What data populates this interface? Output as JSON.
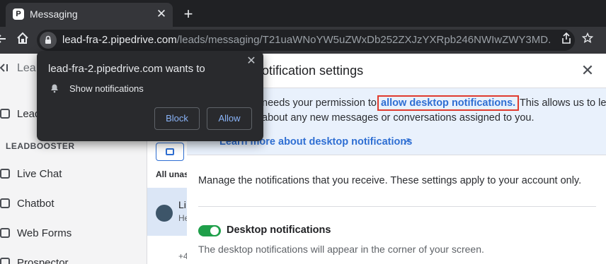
{
  "browser": {
    "tab_title": "Messaging",
    "tab_favicon": "P",
    "tab_close": "✕",
    "new_tab": "+",
    "url_host": "lead-fra-2.pipedrive.com",
    "url_path": "/leads/messaging/T21uaWNoYW5uZWxDb252ZXJzYXRpb246NWIwZWY3MD...",
    "icons": {
      "back": "back-icon",
      "home": "home-icon",
      "share": "share-icon",
      "star": "star-icon"
    }
  },
  "permission_popup": {
    "title": "lead-fra-2.pipedrive.com wants to",
    "permission": "Show notifications",
    "block_label": "Block",
    "allow_label": "Allow",
    "close": "✕"
  },
  "sidebar": {
    "header": "Lea",
    "top_item": "Lead",
    "section_title": "LEADBOOSTER",
    "items": [
      {
        "label": "Live Chat",
        "icon": "live-chat-icon"
      },
      {
        "label": "Chatbot",
        "icon": "chatbot-icon"
      },
      {
        "label": "Web Forms",
        "icon": "web-forms-icon"
      },
      {
        "label": "Prospector",
        "icon": "prospector-icon"
      }
    ]
  },
  "list": {
    "filter_label": "All unas",
    "row_title": "Li",
    "row_sub": "He",
    "row2_count": "+4"
  },
  "modal": {
    "title": "otification settings",
    "close": "✕",
    "banner_pre": "needs your permission to ",
    "banner_link": "allow desktop notifications.",
    "banner_post": " This allows us to let",
    "banner_line2": "about any new messages or conversations assigned to you.",
    "learn_more": "Learn more about desktop notifications",
    "learn_arrow": "↗",
    "manage_text": "Manage the notifications that you receive. These settings apply to your account only.",
    "desktop_toggle_label": "Desktop notifications",
    "desktop_toggle_on": true,
    "desktop_toggle_desc": "The desktop notifications will appear in the corner of your screen."
  },
  "colors": {
    "accent": "#2f6fd3",
    "highlight_box": "#e03a2e",
    "toggle_on": "#1f9f4a",
    "browser_dark": "#202124"
  }
}
